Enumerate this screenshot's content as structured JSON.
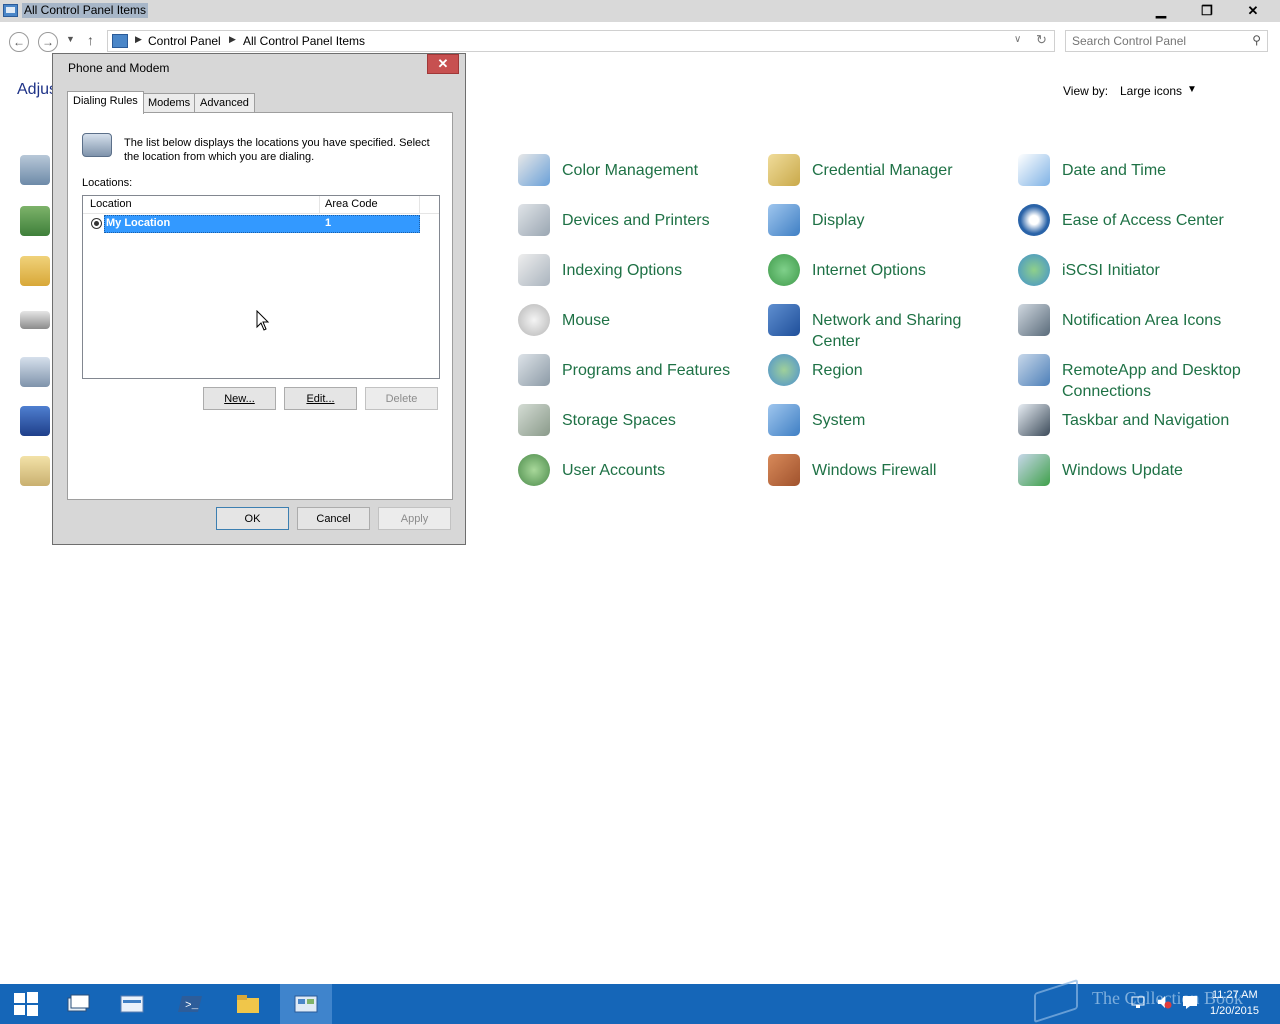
{
  "window": {
    "title": "All Control Panel Items",
    "controls": {
      "minimize": "▁",
      "maximize": "❐",
      "close": "✕"
    }
  },
  "address": {
    "crumbs": [
      "Control Panel",
      "All Control Panel Items"
    ],
    "search_placeholder": "Search Control Panel"
  },
  "content": {
    "adjust_label": "Adjus",
    "view_by_label": "View by:",
    "view_by_value": "Large icons",
    "items": [
      {
        "label": "Color Management",
        "icon": "color-management-icon",
        "color": "#6aa0d8"
      },
      {
        "label": "Credential Manager",
        "icon": "credential-manager-icon",
        "color": "#c9a94a"
      },
      {
        "label": "Date and Time",
        "icon": "date-and-time-icon",
        "color": "#7fb2e5"
      },
      {
        "label": "Devices and Printers",
        "icon": "devices-and-printers-icon",
        "color": "#9aa6b2"
      },
      {
        "label": "Display",
        "icon": "display-icon",
        "color": "#3f7fc4"
      },
      {
        "label": "Ease of Access Center",
        "icon": "ease-of-access-icon",
        "color": "#2a63a8"
      },
      {
        "label": "Indexing Options",
        "icon": "indexing-options-icon",
        "color": "#aab4be"
      },
      {
        "label": "Internet Options",
        "icon": "internet-options-icon",
        "color": "#3f9a4a"
      },
      {
        "label": "iSCSI Initiator",
        "icon": "iscsi-initiator-icon",
        "color": "#3f8fcf"
      },
      {
        "label": "Mouse",
        "icon": "mouse-icon",
        "color": "#b5b5b5"
      },
      {
        "label": "Network and Sharing Center",
        "icon": "network-sharing-icon",
        "color": "#1f4f9a"
      },
      {
        "label": "Notification Area Icons",
        "icon": "notification-area-icon",
        "color": "#5a6b7a"
      },
      {
        "label": "Programs and Features",
        "icon": "programs-features-icon",
        "color": "#8c9aa6"
      },
      {
        "label": "Region",
        "icon": "region-icon",
        "color": "#4a8fd0"
      },
      {
        "label": "RemoteApp and Desktop Connections",
        "icon": "remoteapp-icon",
        "color": "#4d7fb8"
      },
      {
        "label": "Storage Spaces",
        "icon": "storage-spaces-icon",
        "color": "#8a9a8a"
      },
      {
        "label": "System",
        "icon": "system-icon",
        "color": "#3f7fc4"
      },
      {
        "label": "Taskbar and Navigation",
        "icon": "taskbar-navigation-icon",
        "color": "#3c4b5a"
      },
      {
        "label": "User Accounts",
        "icon": "user-accounts-icon",
        "color": "#4a8a4a"
      },
      {
        "label": "Windows Firewall",
        "icon": "windows-firewall-icon",
        "color": "#a0522d"
      },
      {
        "label": "Windows Update",
        "icon": "windows-update-icon",
        "color": "#3fa04a"
      }
    ]
  },
  "dialog": {
    "title": "Phone and Modem",
    "close": "✕",
    "tabs": [
      "Dialing Rules",
      "Modems",
      "Advanced"
    ],
    "description": "The list below displays the locations you have specified. Select the location from which you are dialing.",
    "locations_label": "Locations:",
    "columns": [
      "Location",
      "Area Code"
    ],
    "rows": [
      {
        "location": "My Location",
        "area_code": "1"
      }
    ],
    "buttons": {
      "new": "New...",
      "edit": "Edit...",
      "delete": "Delete"
    },
    "footer": {
      "ok": "OK",
      "cancel": "Cancel",
      "apply": "Apply"
    }
  },
  "taskbar": {
    "time": "11:27 AM",
    "date": "1/20/2015",
    "watermark": "The Collection Book"
  }
}
